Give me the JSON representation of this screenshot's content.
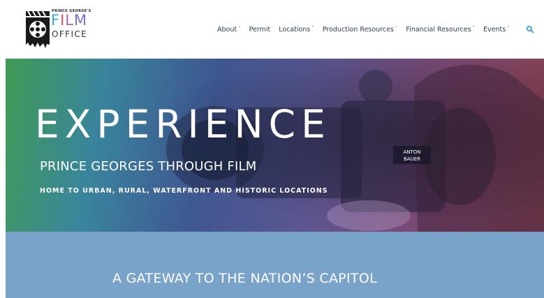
{
  "header": {
    "logo": {
      "tagline": "PRINCE GEORGE'S",
      "film_letters": [
        "F",
        "I",
        "L",
        "M"
      ],
      "film_colors": [
        "#3ea8d6",
        "#e2525f",
        "#b462b8",
        "#7a6dc8"
      ],
      "office": "OFFICE"
    },
    "nav": {
      "items": [
        {
          "label": "About",
          "has_dropdown": true
        },
        {
          "label": "Permit",
          "has_dropdown": false
        },
        {
          "label": "Locations",
          "has_dropdown": true
        },
        {
          "label": "Production Resources",
          "has_dropdown": true
        },
        {
          "label": "Financial Resources",
          "has_dropdown": true
        },
        {
          "label": "Events",
          "has_dropdown": true
        }
      ],
      "caret": "ˇ",
      "search_icon": "search-icon"
    }
  },
  "hero": {
    "title": "EXPERIENCE",
    "subtitle": "PRINCE GEORGES THROUGH FILM",
    "tagline": "HOME TO URBAN, RURAL, WATERFRONT AND HISTORIC LOCATIONS",
    "camera_brand": "ANTON BAUER"
  },
  "band": {
    "title": "A GATEWAY TO THE NATION’S CAPITOL"
  },
  "colors": {
    "nav_text": "#2d3e52",
    "search_accent": "#3a8fd0",
    "band_background": "#79a3c9"
  }
}
